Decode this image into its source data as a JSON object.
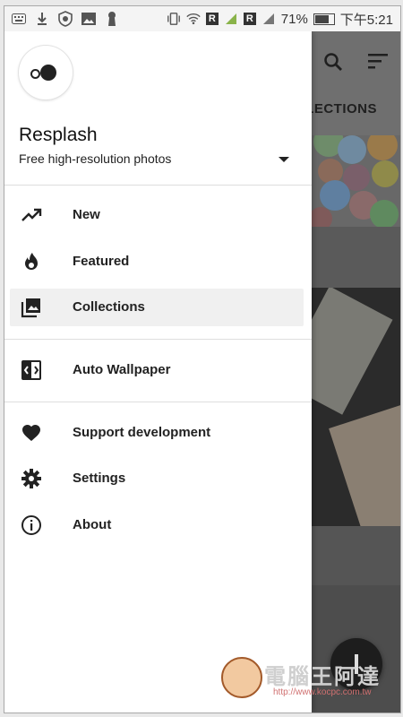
{
  "status_bar": {
    "carrier_box_1": "R",
    "carrier_box_2": "R",
    "battery_percent": "71%",
    "time": "下午5:21",
    "icons": [
      "keyboard-icon",
      "download-icon",
      "shield-icon",
      "image-icon",
      "keyhole-icon",
      "vibrate-icon",
      "wifi-icon",
      "signal-icon",
      "battery-icon"
    ]
  },
  "app_behind": {
    "tab_label": "LLECTIONS",
    "icons": [
      "search-icon",
      "sort-icon",
      "upload-icon"
    ]
  },
  "drawer": {
    "title": "Resplash",
    "subtitle": "Free high-resolution photos",
    "menu": [
      {
        "label": "New",
        "icon": "trending-up-icon"
      },
      {
        "label": "Featured",
        "icon": "flame-icon"
      },
      {
        "label": "Collections",
        "icon": "photo-library-icon",
        "selected": true
      },
      {
        "label": "Auto Wallpaper",
        "icon": "wallpaper-icon"
      },
      {
        "label": "Support development",
        "icon": "heart-icon"
      },
      {
        "label": "Settings",
        "icon": "gear-icon"
      },
      {
        "label": "About",
        "icon": "info-icon"
      }
    ]
  },
  "watermark": {
    "text": "電腦王阿達",
    "url": "http://www.kocpc.com.tw"
  },
  "colors": {
    "drawer_bg": "#ffffff",
    "selected_item_bg": "#f0f0f0",
    "scrim": "#5e5e5e",
    "text_primary": "#222222"
  }
}
